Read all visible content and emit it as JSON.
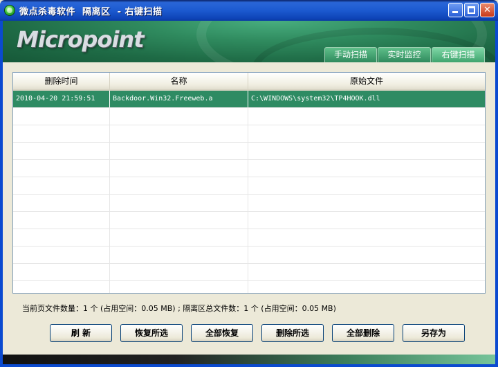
{
  "window": {
    "title": "微点杀毒软件  隔离区  - 右键扫描",
    "minimize_label": "",
    "maximize_label": "",
    "close_label": "✕"
  },
  "banner": {
    "logo_text": "Micropoint"
  },
  "tabs": [
    {
      "label": "手动扫描"
    },
    {
      "label": "实时监控"
    },
    {
      "label": "右键扫描"
    }
  ],
  "table": {
    "columns": [
      "删除时间",
      "名称",
      "原始文件"
    ],
    "rows": [
      {
        "time": "2010-04-20 21:59:51",
        "name": "Backdoor.Win32.Freeweb.a",
        "file": "C:\\WINDOWS\\system32\\TP4HOOK.dll"
      }
    ]
  },
  "status": {
    "text": "当前页文件数量：1 个 (占用空间：0.05 MB) ; 隔离区总文件数：1 个 (占用空间：0.05 MB)"
  },
  "buttons": {
    "refresh": "刷    新",
    "restore_selected": "恢复所选",
    "restore_all": "全部恢复",
    "delete_selected": "删除所选",
    "delete_all": "全部删除",
    "save_as": "另存为"
  },
  "colors": {
    "selected_row": "#2e8b63",
    "banner_green": "#2f8a5e",
    "titlebar_blue": "#1c5ad0"
  }
}
